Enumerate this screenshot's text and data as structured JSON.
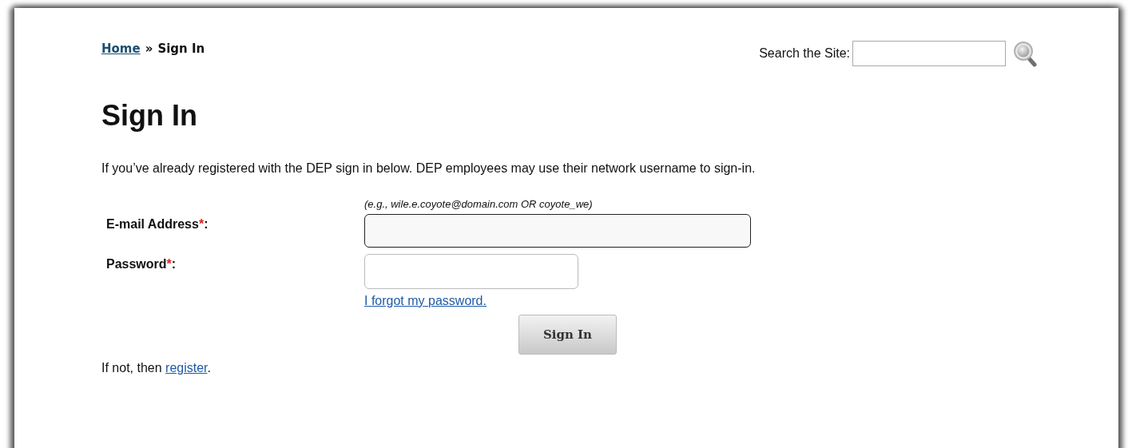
{
  "breadcrumb": {
    "home": "Home",
    "separator": "»",
    "current": "Sign In"
  },
  "search": {
    "label": "Search the Site:"
  },
  "heading": "Sign In",
  "intro": "If you’ve already registered with the DEP sign in below. DEP employees may use their network username to sign-in.",
  "form": {
    "hint": "(e.g., wile.e.coyote@domain.com OR coyote_we)",
    "required_mark": "*",
    "label_suffix": ":",
    "fields": [
      {
        "label": "E-mail Address",
        "kind": "email",
        "required": true,
        "focused": true
      },
      {
        "label": "Password",
        "kind": "password",
        "required": true,
        "focused": false
      }
    ],
    "forgot_link": "I forgot my password.",
    "submit": "Sign In"
  },
  "register": {
    "prefix": "If not, then",
    "link": "register",
    "suffix": "."
  }
}
